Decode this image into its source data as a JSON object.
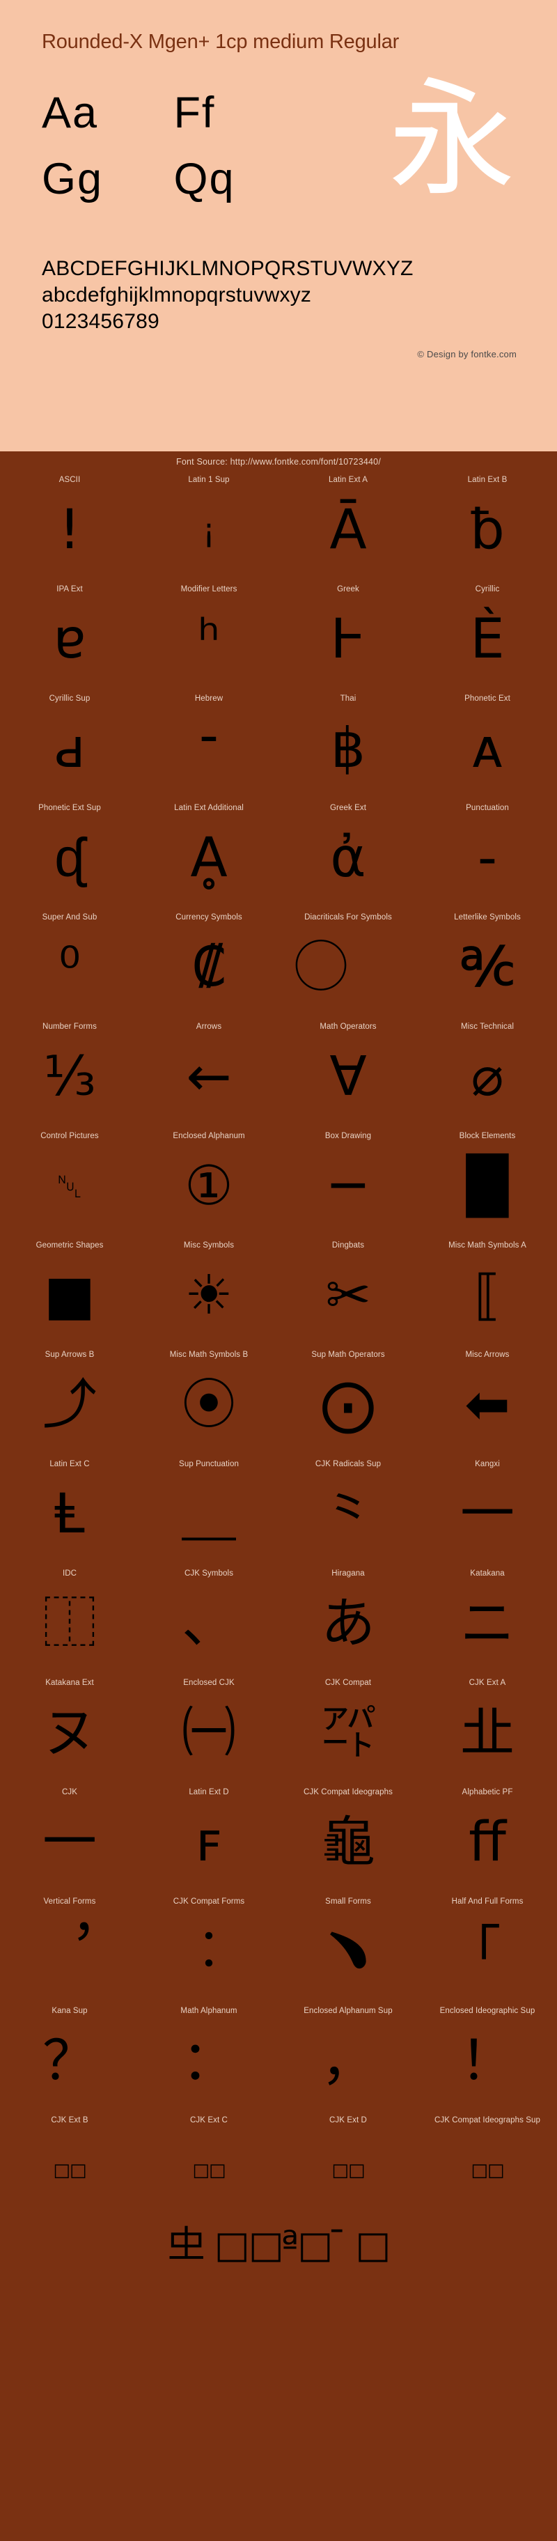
{
  "specimen": {
    "title": "Rounded-X Mgen+ 1cp medium Regular",
    "pairs": [
      "Aa",
      "Ff",
      "Gg",
      "Qq"
    ],
    "cjk_sample": "永",
    "uppercase": "ABCDEFGHIJKLMNOPQRSTUVWXYZ",
    "lowercase": "abcdefghijklmnopqrstuvwxyz",
    "digits": "0123456789",
    "copyright": "© Design by fontke.com",
    "source": "Font Source: http://www.fontke.com/font/10723440/",
    "colors": {
      "panel_bg": "#f7c5a6",
      "page_bg": "#7a3112",
      "title_color": "#7a3112",
      "glyph_color": "#000000",
      "cjk_color": "#ffffff",
      "label_color": "#e9d3c5"
    }
  },
  "blocks": [
    {
      "label": "ASCII",
      "glyph": "!",
      "size": "lg"
    },
    {
      "label": "Latin 1 Sup",
      "glyph": "¡",
      "size": "sm"
    },
    {
      "label": "Latin Ext A",
      "glyph": "Ā",
      "size": "lg"
    },
    {
      "label": "Latin Ext B",
      "glyph": "ƀ",
      "size": "lg"
    },
    {
      "label": "IPA Ext",
      "glyph": "ɐ",
      "size": "lg"
    },
    {
      "label": "Modifier Letters",
      "glyph": "ʰ",
      "size": "lg"
    },
    {
      "label": "Greek",
      "glyph": "Ͱ",
      "size": "lg"
    },
    {
      "label": "Cyrillic",
      "glyph": "Ѐ",
      "size": "lg"
    },
    {
      "label": "Cyrillic Sup",
      "glyph": "ԁ",
      "size": "lg"
    },
    {
      "label": "Hebrew",
      "glyph": "־",
      "size": "lg"
    },
    {
      "label": "Thai",
      "glyph": "฿",
      "size": "lg"
    },
    {
      "label": "Phonetic Ext",
      "glyph": "ᴀ",
      "size": "lg"
    },
    {
      "label": "Phonetic Ext Sup",
      "glyph": "ᶑ",
      "size": "lg"
    },
    {
      "label": "Latin Ext Additional",
      "glyph": "Ḁ",
      "size": "lg"
    },
    {
      "label": "Greek Ext",
      "glyph": "ἀ",
      "size": "lg"
    },
    {
      "label": "Punctuation",
      "glyph": "‐",
      "size": "lg"
    },
    {
      "label": "Super And Sub",
      "glyph": "⁰",
      "size": "lg"
    },
    {
      "label": "Currency Symbols",
      "glyph": "₡",
      "size": "lg"
    },
    {
      "label": "Diacriticals For Symbols",
      "glyph": "⃝",
      "size": "lg"
    },
    {
      "label": "Letterlike Symbols",
      "glyph": "℀",
      "size": "lg"
    },
    {
      "label": "Number Forms",
      "glyph": "⅓",
      "size": "lg"
    },
    {
      "label": "Arrows",
      "glyph": "←",
      "size": "lg"
    },
    {
      "label": "Math Operators",
      "glyph": "∀",
      "size": "lg"
    },
    {
      "label": "Misc Technical",
      "glyph": "⌀",
      "size": "lg"
    },
    {
      "label": "Control Pictures",
      "glyph": "␀",
      "size": "sm"
    },
    {
      "label": "Enclosed Alphanum",
      "glyph": "①",
      "size": "lg"
    },
    {
      "label": "Box Drawing",
      "glyph": "─",
      "size": "lg"
    },
    {
      "label": "Block Elements",
      "glyph": "█",
      "size": "lg"
    },
    {
      "label": "Geometric Shapes",
      "glyph": "■",
      "size": "lg"
    },
    {
      "label": "Misc Symbols",
      "glyph": "☀",
      "size": "lg"
    },
    {
      "label": "Dingbats",
      "glyph": "✂",
      "size": "lg"
    },
    {
      "label": "Misc Math Symbols A",
      "glyph": "⟦",
      "size": "lg"
    },
    {
      "label": "Sup Arrows B",
      "glyph": "⤴",
      "size": "lg"
    },
    {
      "label": "Misc Math Symbols B",
      "glyph": "⦿",
      "size": "lg"
    },
    {
      "label": "Sup Math Operators",
      "glyph": "⨀",
      "size": "lg"
    },
    {
      "label": "Misc Arrows",
      "glyph": "⬅",
      "size": "lg"
    },
    {
      "label": "Latin Ext C",
      "glyph": "Ⱡ",
      "size": "lg"
    },
    {
      "label": "Sup Punctuation",
      "glyph": "⸏",
      "size": "lg"
    },
    {
      "label": "CJK Radicals Sup",
      "glyph": "⺀",
      "size": "lg"
    },
    {
      "label": "Kangxi",
      "glyph": "⼀",
      "size": "lg"
    },
    {
      "label": "IDC",
      "glyph": "⿰",
      "size": "lg"
    },
    {
      "label": "CJK Symbols",
      "glyph": "、",
      "size": "lg"
    },
    {
      "label": "Hiragana",
      "glyph": "あ",
      "size": "lg"
    },
    {
      "label": "Katakana",
      "glyph": "ニ",
      "size": "lg"
    },
    {
      "label": "Katakana Ext",
      "glyph": "ヌ",
      "size": "lg"
    },
    {
      "label": "Enclosed CJK",
      "glyph": "㈠",
      "size": "lg"
    },
    {
      "label": "CJK Compat",
      "glyph": "㌀",
      "size": "lg"
    },
    {
      "label": "CJK Ext A",
      "glyph": "㐀",
      "size": "lg"
    },
    {
      "label": "CJK",
      "glyph": "一",
      "size": "lg"
    },
    {
      "label": "Latin Ext D",
      "glyph": "ꜰ",
      "size": "lg"
    },
    {
      "label": "CJK Compat Ideographs",
      "glyph": "龜",
      "size": "lg"
    },
    {
      "label": "Alphabetic PF",
      "glyph": "ﬀ",
      "size": "lg"
    },
    {
      "label": "Vertical Forms",
      "glyph": "︐",
      "size": "lg"
    },
    {
      "label": "CJK Compat Forms",
      "glyph": "︰",
      "size": "lg"
    },
    {
      "label": "Small Forms",
      "glyph": "﹅",
      "size": "lg"
    },
    {
      "label": "Half And Full Forms",
      "glyph": "｢",
      "size": "lg"
    },
    {
      "label": "Kana Sup",
      "glyph": "？",
      "size": "lg"
    },
    {
      "label": "Math Alphanum",
      "glyph": "：",
      "size": "lg"
    },
    {
      "label": "Enclosed Alphanum Sup",
      "glyph": "，",
      "size": "lg"
    },
    {
      "label": "Enclosed Ideographic Sup",
      "glyph": "！",
      "size": "lg"
    },
    {
      "label": "CJK Ext B",
      "glyph": "𠀀□□𠀁",
      "size": "tiny"
    },
    {
      "label": "CJK Ext C",
      "glyph": "𪜀□□𪜁",
      "size": "tiny"
    },
    {
      "label": "CJK Ext D",
      "glyph": "𫝀□□𫝁",
      "size": "tiny"
    },
    {
      "label": "CJK Compat Ideographs Sup",
      "glyph": "𪜀□□𪜁",
      "size": "tiny"
    }
  ],
  "bottom_row": [
    {
      "label": "",
      "glyph": "𠀐 □□𠁀ª□𠀰《𠁐¯ □"
    }
  ]
}
